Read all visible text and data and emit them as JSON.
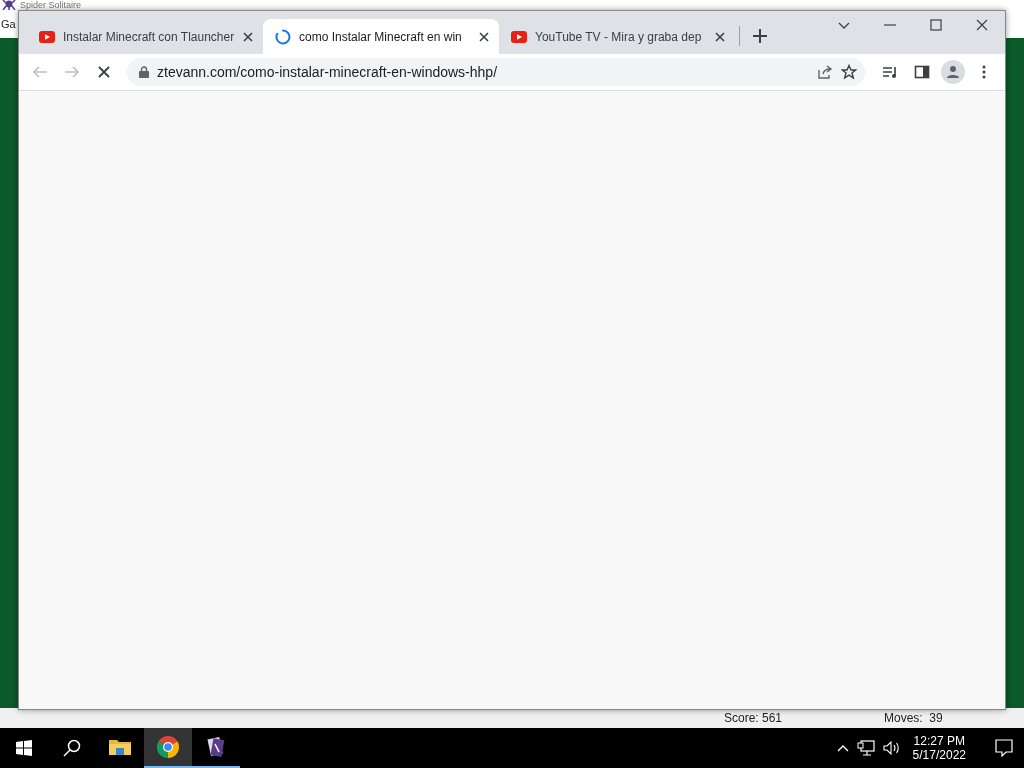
{
  "background_window": {
    "title": "Spider Solitaire",
    "menu": [
      "Ga"
    ],
    "status_bar": {
      "score": "Score: 561",
      "moves": "Moves:  39"
    }
  },
  "browser": {
    "tabs": [
      {
        "title": "Instalar Minecraft con Tlauncher",
        "kind": "video",
        "selected": false
      },
      {
        "title": "como Instalar Minecraft en win",
        "kind": "loading",
        "selected": true
      },
      {
        "title": "YouTube TV - Mira y graba dep",
        "kind": "video",
        "selected": false
      }
    ],
    "address": "ztevann.com/como-instalar-minecraft-en-windows-hhp/",
    "loading": true
  },
  "taskbar": {
    "apps": [
      {
        "kind": "folder",
        "open": false,
        "focused": false
      },
      {
        "kind": "chrome",
        "open": true,
        "focused": true
      },
      {
        "kind": "solitaire",
        "open": true,
        "focused": false
      }
    ],
    "time": "12:27 PM",
    "date": "5/17/2022"
  }
}
